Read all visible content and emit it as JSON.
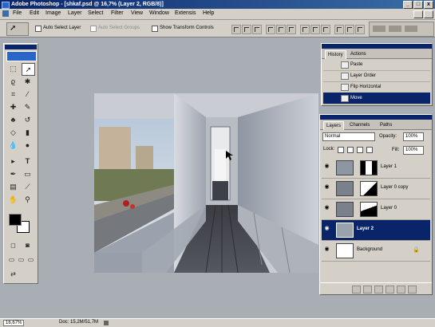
{
  "window": {
    "title": "Adobe Photoshop - [shkaf.psd @ 16,7% (Layer 2, RGB/8)]",
    "min_glyph": "_",
    "max_glyph": "□",
    "close_glyph": "x"
  },
  "menu": [
    "File",
    "Edit",
    "Image",
    "Layer",
    "Select",
    "Filter",
    "View",
    "Window",
    "Extensis",
    "Help"
  ],
  "options": {
    "auto_select_layer": "Auto Select Layer",
    "auto_select_groups": "Auto Select Groups",
    "show_transform_controls": "Show Transform Controls"
  },
  "history_palette": {
    "tabs": [
      "History",
      "Actions"
    ],
    "items": [
      "Paste",
      "Layer Order",
      "Flip Horizontal",
      "Move"
    ],
    "selected": "Move"
  },
  "layers_palette": {
    "tabs": [
      "Layers",
      "Channels",
      "Paths"
    ],
    "blend_mode": "Normal",
    "opacity_label": "Opacity:",
    "opacity_value": "100%",
    "lock_label": "Lock:",
    "fill_label": "Fill:",
    "fill_value": "100%",
    "layers": [
      {
        "name": "Layer 1",
        "selected": false
      },
      {
        "name": "Layer 0 copy",
        "selected": false
      },
      {
        "name": "Layer 0",
        "selected": false
      },
      {
        "name": "Layer 2",
        "selected": true
      },
      {
        "name": "Background",
        "selected": false
      }
    ]
  },
  "status": {
    "zoom": "16,67%",
    "doc": "Doc: 15,2M/51,7M"
  },
  "colors": {
    "selection": "#0a246a",
    "chrome": "#d4d0c8",
    "workspace": "#a9adb4"
  }
}
